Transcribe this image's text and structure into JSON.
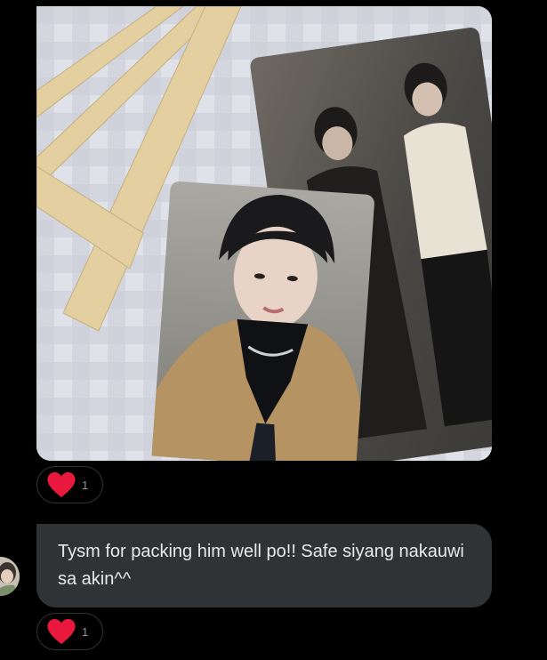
{
  "conversation": {
    "messages": [
      {
        "type": "photo",
        "reaction": {
          "emoji": "heart-icon",
          "count": "1"
        }
      },
      {
        "type": "text",
        "text": "Tysm for packing him well po!! Safe siyang nakauwi sa akin^^",
        "reaction": {
          "emoji": "heart-icon",
          "count": "1"
        }
      }
    ]
  },
  "colors": {
    "background": "#000000",
    "bubble": "#2f3336",
    "bubble_text": "#e7e9ea",
    "reaction_border": "#2f3336",
    "reaction_count": "#8b98a5",
    "heart": "#f91880"
  }
}
